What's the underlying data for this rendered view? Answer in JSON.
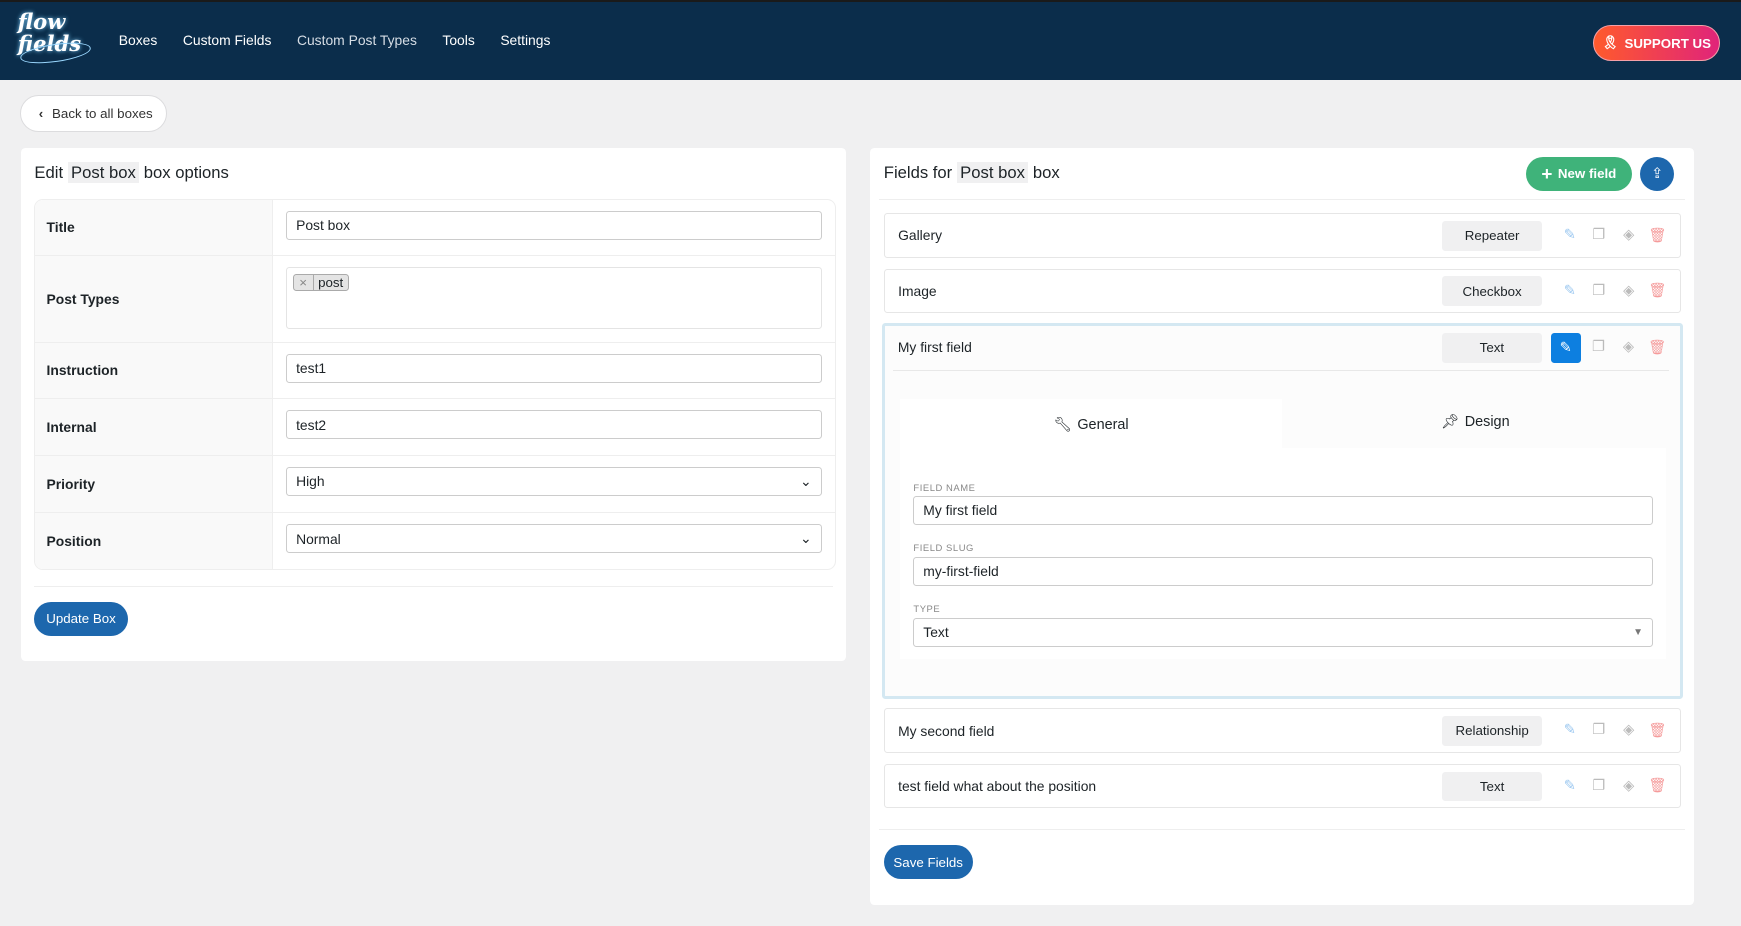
{
  "nav": {
    "logo": "flow fields",
    "items": [
      "Boxes",
      "Custom Fields",
      "Custom Post Types",
      "Tools",
      "Settings"
    ],
    "support": "SUPPORT US"
  },
  "back": "Back to all boxes",
  "left": {
    "title_pre": "Edit",
    "box_name": "Post box",
    "title_post": "box options",
    "rows": [
      {
        "label": "Title",
        "value": "Post box"
      },
      {
        "label": "Post Types",
        "tag": "post"
      },
      {
        "label": "Instruction",
        "value": "test1"
      },
      {
        "label": "Internal",
        "value": "test2"
      },
      {
        "label": "Priority",
        "value": "High"
      },
      {
        "label": "Position",
        "value": "Normal"
      }
    ],
    "update": "Update Box"
  },
  "right": {
    "title_pre": "Fields for",
    "box_name": "Post box",
    "title_post": "box",
    "new_field": "New field",
    "fields": [
      {
        "name": "Gallery",
        "type": "Repeater"
      },
      {
        "name": "Image",
        "type": "Checkbox"
      },
      {
        "name": "My first field",
        "type": "Text"
      },
      {
        "name": "My second field",
        "type": "Relationship"
      },
      {
        "name": "test field what about the position",
        "type": "Text"
      }
    ],
    "editor": {
      "tab_general": "General",
      "tab_design": "Design",
      "name_label": "FIELD NAME",
      "name_value": "My first field",
      "slug_label": "FIELD SLUG",
      "slug_value": "my-first-field",
      "type_label": "TYPE",
      "type_value": "Text"
    },
    "save": "Save Fields"
  },
  "colors": {
    "header": "#0b2d4b",
    "primary": "#1d67ad",
    "green": "#3fb37a"
  }
}
